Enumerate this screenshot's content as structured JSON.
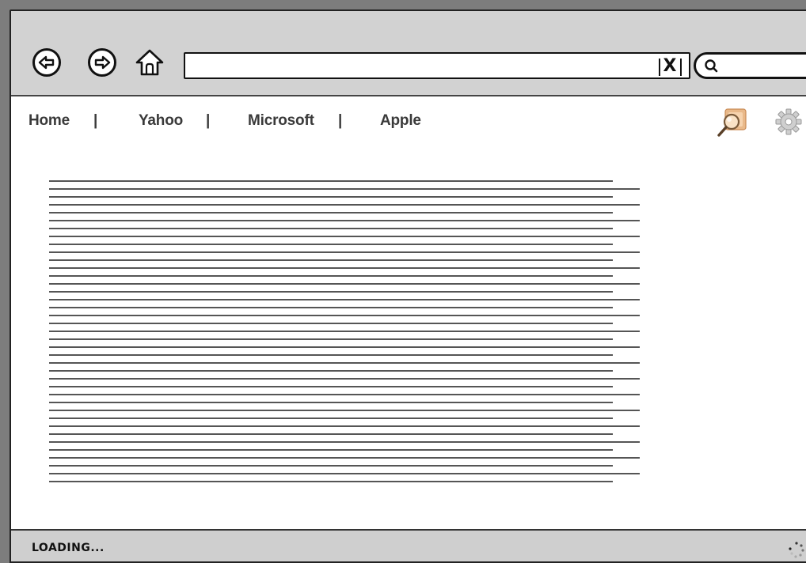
{
  "toolbar": {
    "address_value": "",
    "clear_label": "X",
    "search_value": ""
  },
  "nav": {
    "links": [
      {
        "label": "Home"
      },
      {
        "label": "Yahoo"
      },
      {
        "label": "Microsoft"
      },
      {
        "label": "Apple"
      }
    ],
    "separator": "|"
  },
  "icons": {
    "back": "back-arrow-icon",
    "forward": "forward-arrow-icon",
    "home": "home-icon",
    "search": "search-icon",
    "find": "magnifier-icon",
    "settings": "gear-icon",
    "loading": "spinner-icon"
  },
  "status": {
    "text": "LOADING..."
  },
  "colors": {
    "chrome": "#d2d2d2",
    "text_lines": "#555555",
    "frame": "#7d7d7d"
  }
}
